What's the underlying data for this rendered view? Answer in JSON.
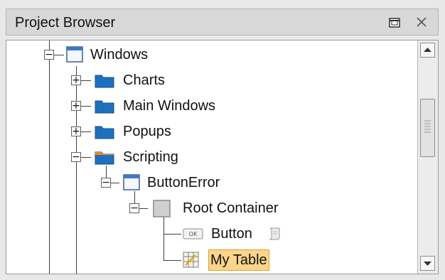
{
  "panel": {
    "title": "Project Browser",
    "restore_icon": "restore-window-icon",
    "close_icon": "close-icon"
  },
  "tree": {
    "windows": {
      "label": "Windows",
      "icon": "window-icon"
    },
    "charts": {
      "label": "Charts",
      "icon": "folder-icon"
    },
    "main_windows": {
      "label": "Main Windows",
      "icon": "folder-icon"
    },
    "popups": {
      "label": "Popups",
      "icon": "folder-icon"
    },
    "scripting": {
      "label": "Scripting",
      "icon": "folder-open-icon"
    },
    "button_error": {
      "label": "ButtonError",
      "icon": "window-icon"
    },
    "root_container": {
      "label": "Root Container",
      "icon": "container-icon"
    },
    "button": {
      "label": "Button",
      "icon": "ok-button-icon",
      "badge_icon": "script-icon"
    },
    "my_table": {
      "label": "My Table",
      "icon": "table-icon",
      "selected": true
    }
  },
  "colors": {
    "folder": "#1f6fbf",
    "selection": "#fbd58a"
  }
}
